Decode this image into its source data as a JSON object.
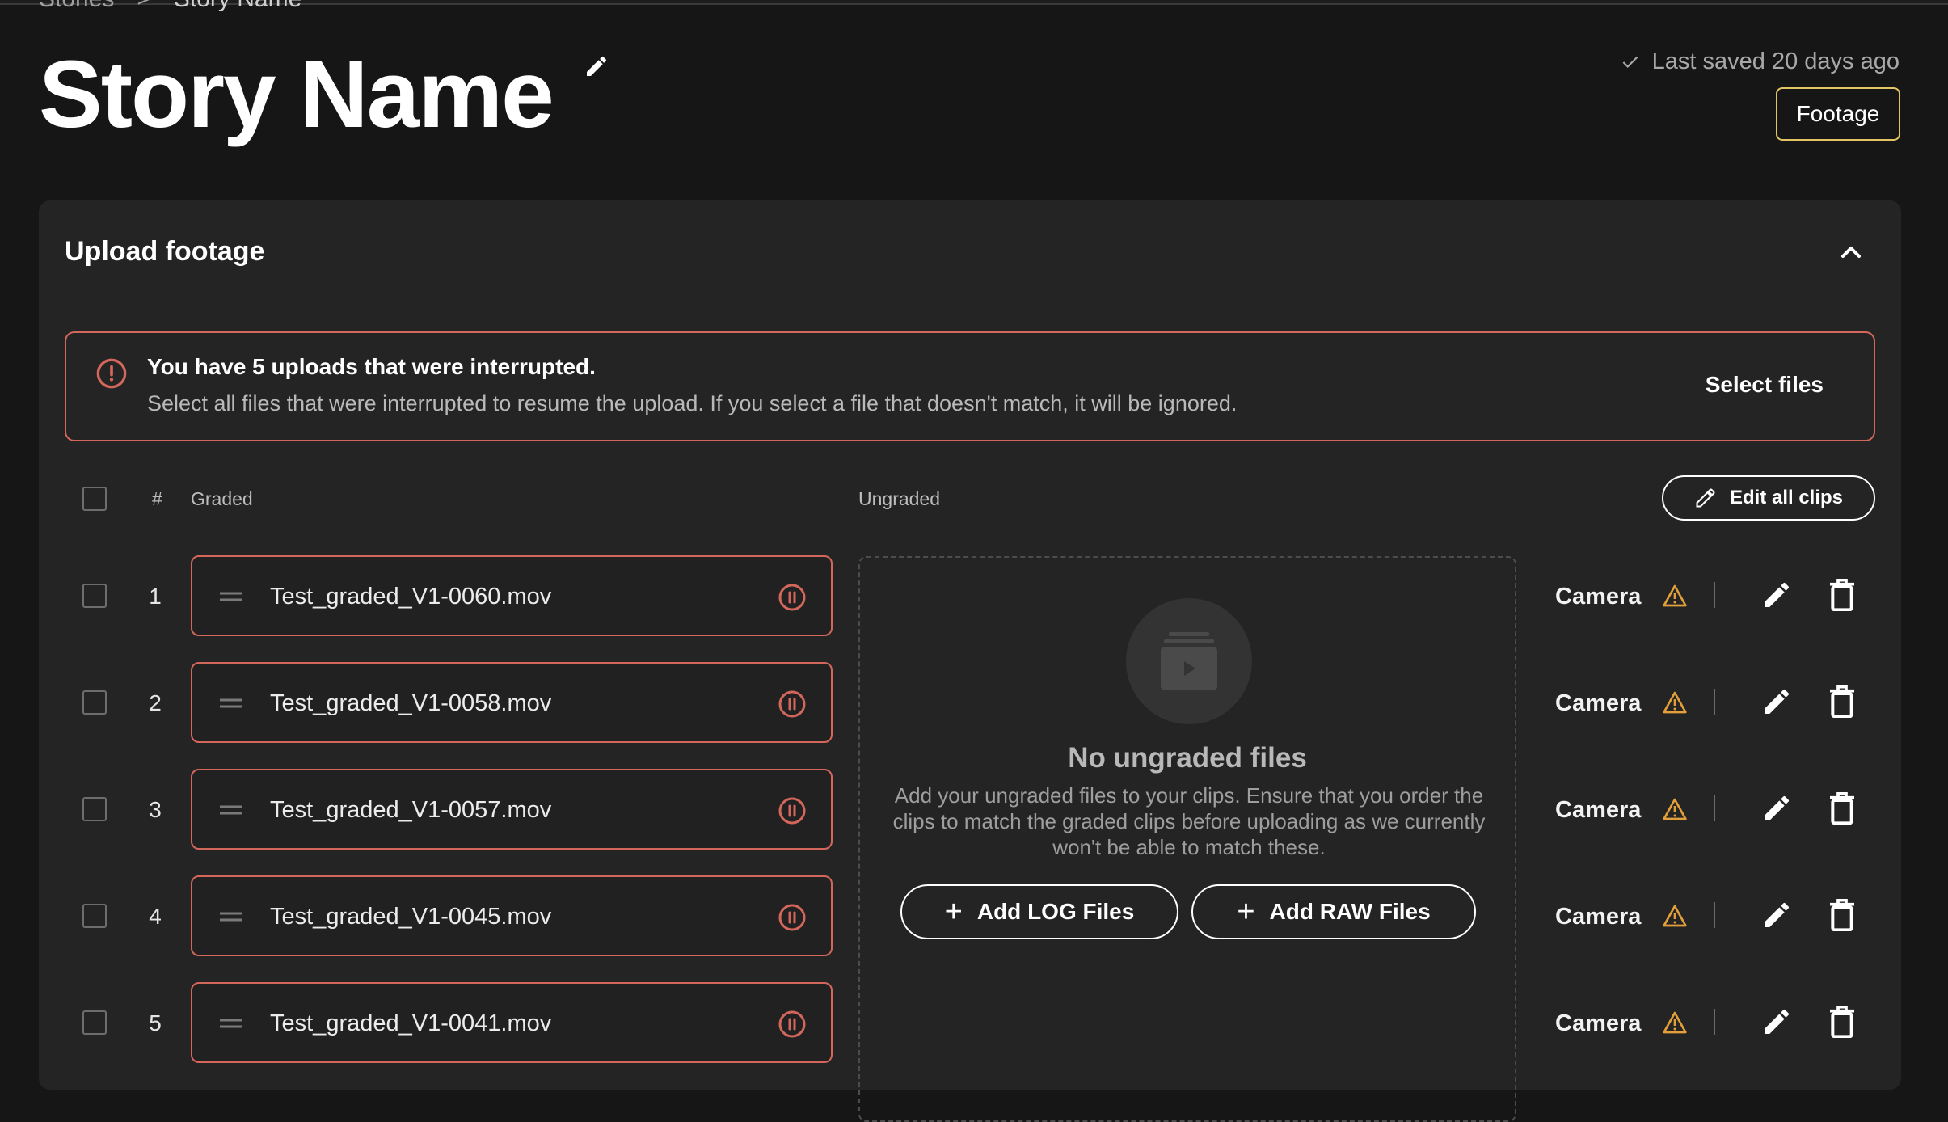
{
  "breadcrumb": {
    "parent": "Stories",
    "separator": ">",
    "current": "Story Name"
  },
  "page": {
    "title": "Story Name"
  },
  "status": {
    "saved_text": "Last saved 20 days ago"
  },
  "header": {
    "footage_button": "Footage"
  },
  "panel": {
    "title": "Upload footage"
  },
  "alert": {
    "title": "You have 5 uploads that were interrupted.",
    "description": "Select all files that were interrupted to resume the upload. If you select a file that doesn't match, it will be ignored.",
    "action": "Select files"
  },
  "table": {
    "headers": {
      "number": "#",
      "graded": "Graded",
      "ungraded": "Ungraded"
    },
    "edit_all_label": "Edit all clips",
    "rows": [
      {
        "num": "1",
        "file": "Test_graded_V1-0060.mov",
        "camera": "Camera"
      },
      {
        "num": "2",
        "file": "Test_graded_V1-0058.mov",
        "camera": "Camera"
      },
      {
        "num": "3",
        "file": "Test_graded_V1-0057.mov",
        "camera": "Camera"
      },
      {
        "num": "4",
        "file": "Test_graded_V1-0045.mov",
        "camera": "Camera"
      },
      {
        "num": "5",
        "file": "Test_graded_V1-0041.mov",
        "camera": "Camera"
      }
    ]
  },
  "ungraded": {
    "title": "No ungraded files",
    "description": "Add your ungraded files to your clips. Ensure that you order the clips to match the graded clips before uploading as we currently won't be able to match these.",
    "add_log": "Add LOG Files",
    "add_raw": "Add RAW Files"
  },
  "colors": {
    "background": "#161616",
    "panel": "#242424",
    "error": "#d4675c",
    "warning": "#e3a03a",
    "accent": "#e2c463"
  },
  "icons": [
    "pencil-icon",
    "check-icon",
    "chevron-up-icon",
    "alert-circle-icon",
    "drag-handle-icon",
    "pause-circle-icon",
    "warning-icon",
    "trash-icon",
    "plus-icon",
    "video-folder-icon"
  ]
}
